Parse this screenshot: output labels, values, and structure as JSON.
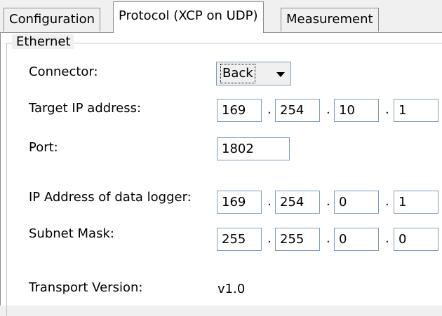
{
  "tabs": [
    {
      "label": "Configuration"
    },
    {
      "label": "Protocol (XCP on UDP)"
    },
    {
      "label": "Measurement"
    }
  ],
  "group": {
    "title": "Ethernet"
  },
  "connector": {
    "label": "Connector:",
    "value": "Back"
  },
  "target_ip": {
    "label": "Target IP address:",
    "octets": [
      "169",
      "254",
      "10",
      "1"
    ]
  },
  "port": {
    "label": "Port:",
    "value": "1802"
  },
  "logger_ip": {
    "label": "IP Address of data logger:",
    "octets": [
      "169",
      "254",
      "0",
      "1"
    ]
  },
  "subnet": {
    "label": "Subnet Mask:",
    "octets": [
      "255",
      "255",
      "0",
      "0"
    ]
  },
  "transport": {
    "label": "Transport Version:",
    "value": "v1.0"
  },
  "separator": "."
}
